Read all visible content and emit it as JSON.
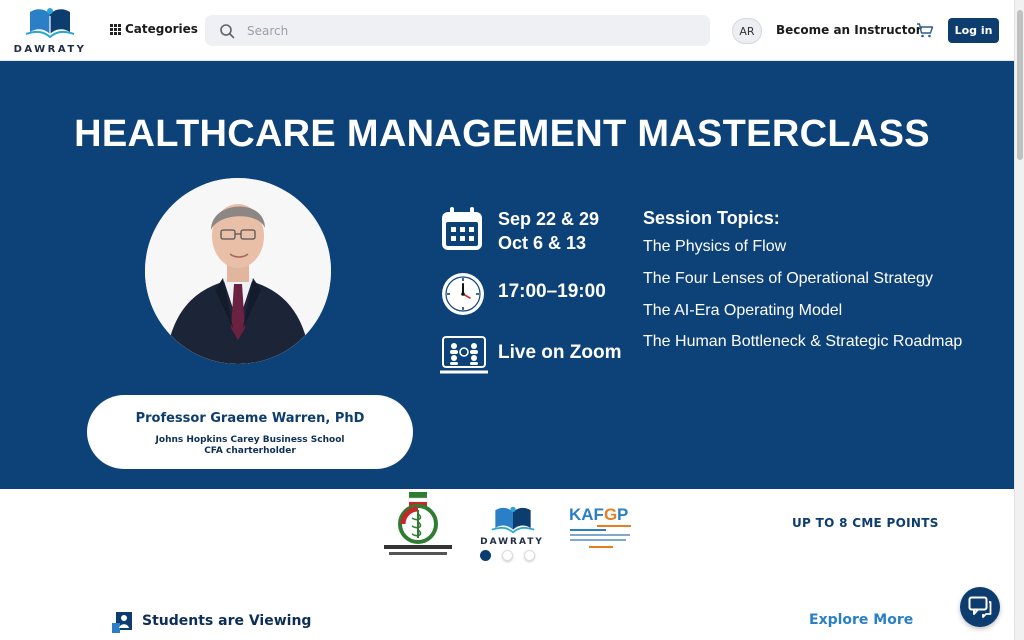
{
  "header": {
    "logo_text": "DAWRATY",
    "categories_label": "Categories",
    "search_placeholder": "Search",
    "language_label": "AR",
    "become_instructor_label": "Become an Instructor",
    "login_label": "Log in"
  },
  "banner": {
    "title": "HEALTHCARE MANAGEMENT MASTERCLASS",
    "dates_line1": "Sep 22 & 29",
    "dates_line2": "Oct 6 & 13",
    "time": "17:00–19:00",
    "location": "Live on Zoom",
    "topics_heading": "Session Topics:",
    "topics": [
      "The Physics of Flow",
      "The Four Lenses of Operational Strategy",
      "The AI-Era Operating Model",
      "The Human Bottleneck & Strategic Roadmap"
    ],
    "speaker": {
      "name": "Professor Graeme Warren, PhD",
      "affiliation": "Johns Hopkins Carey Business School",
      "credential": "CFA charterholder"
    }
  },
  "partners": {
    "logos": [
      "Kuwait Pharmaceutical Association",
      "DAWRATY",
      "KAFGP"
    ],
    "dawraty_logo_text": "DAWRATY",
    "cme_label": "UP TO 8 CME POINTS",
    "carousel_active_index": 0,
    "carousel_count": 3
  },
  "section": {
    "students_viewing_label": "Students are Viewing",
    "explore_more_label": "Explore More"
  },
  "colors": {
    "brand_navy": "#0d4278",
    "button_navy": "#0d3c6e",
    "link_blue": "#2a7fc6"
  },
  "icons": [
    "grid-icon",
    "search-icon",
    "cart-icon",
    "calendar-icon",
    "clock-icon",
    "zoom-meeting-icon",
    "students-icon",
    "chat-icon"
  ]
}
